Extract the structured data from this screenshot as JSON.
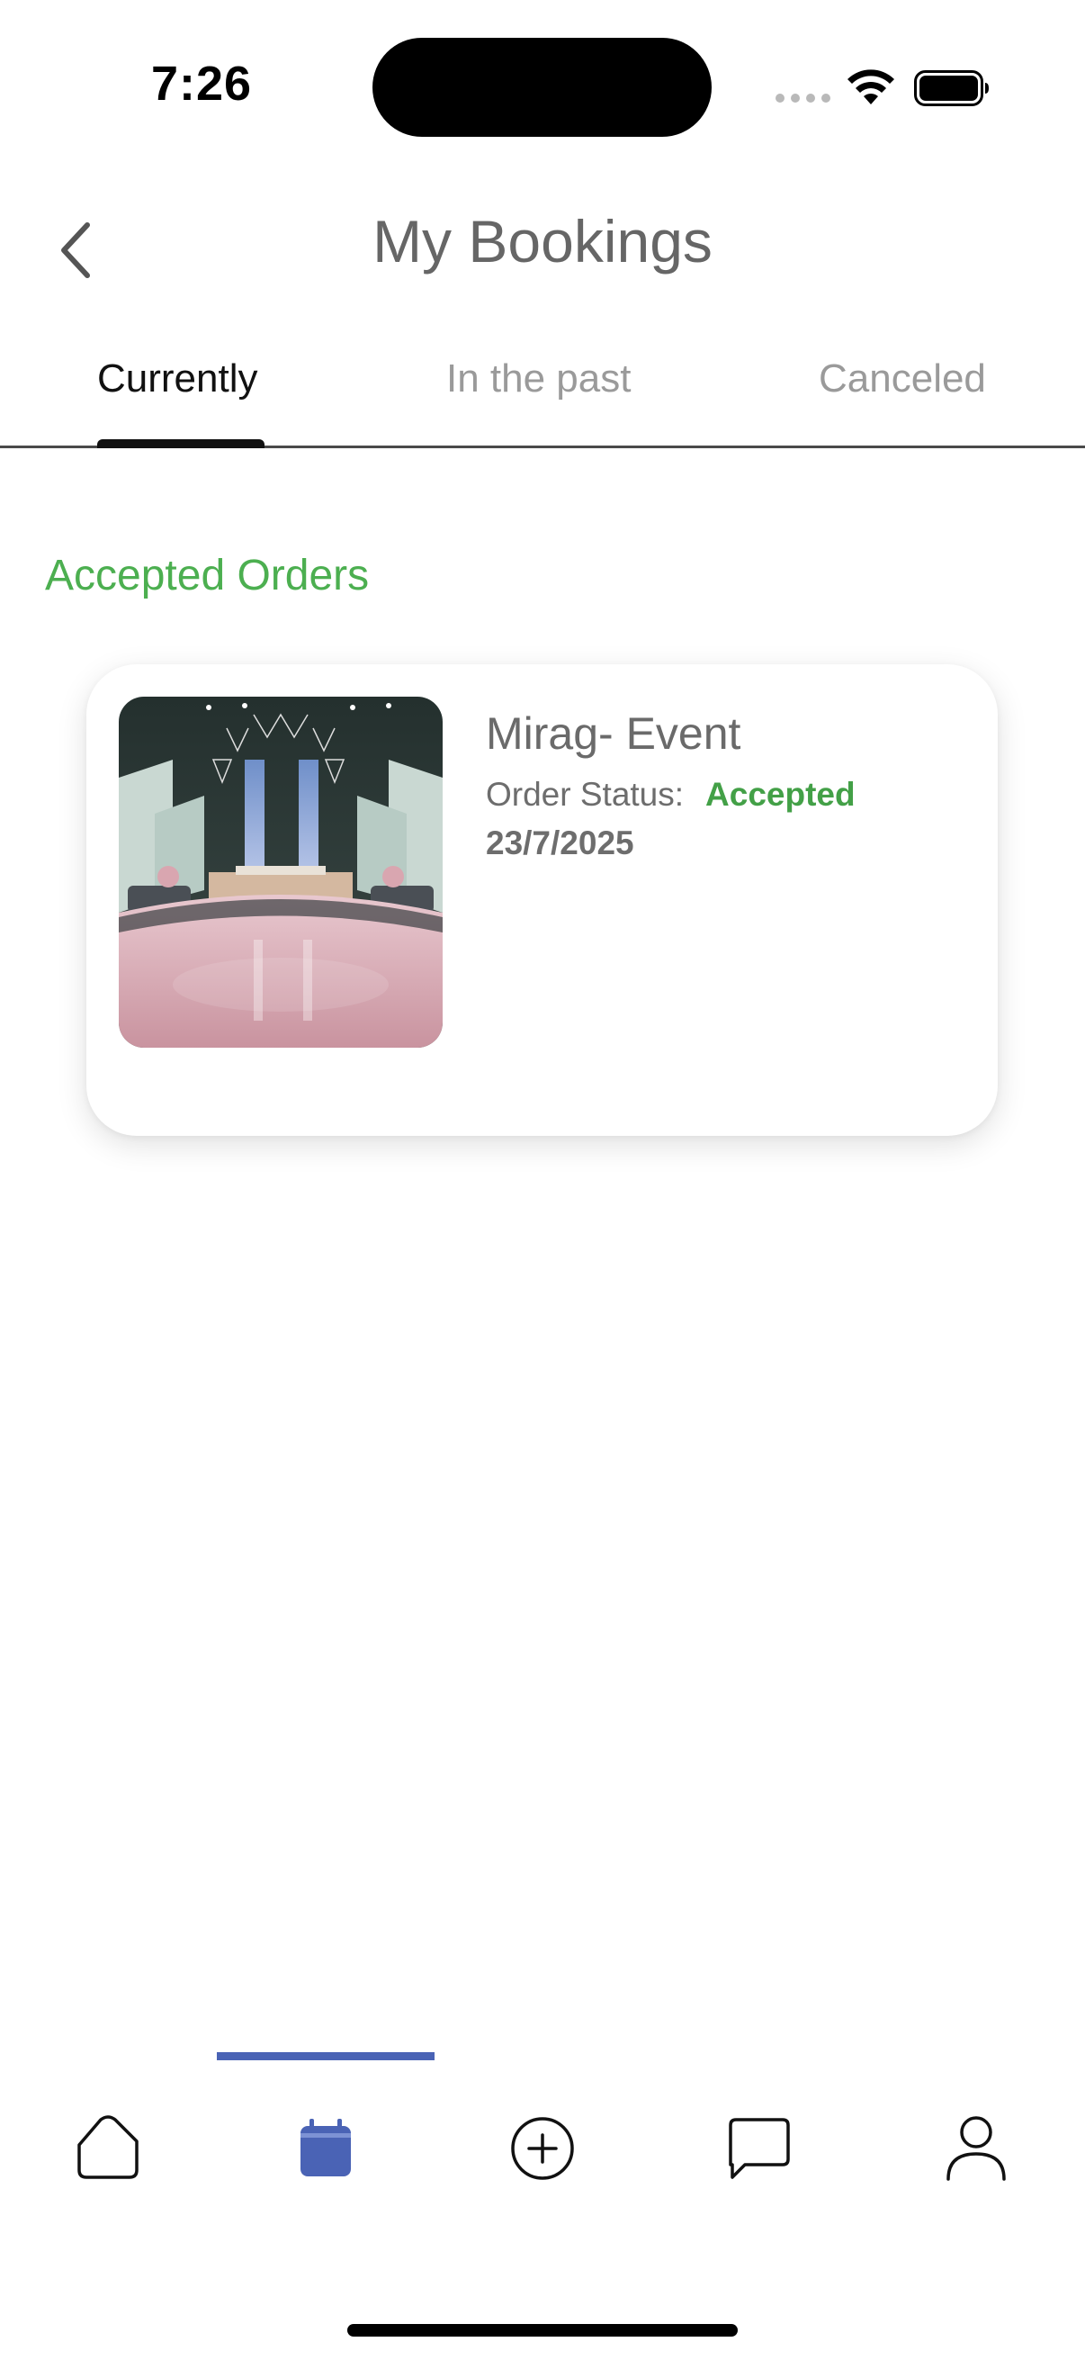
{
  "status_bar": {
    "time": "7:26"
  },
  "header": {
    "title": "My Bookings",
    "back_icon": "chevron-left-icon"
  },
  "tabs": [
    {
      "label": "Currently",
      "active": true
    },
    {
      "label": "In the past",
      "active": false
    },
    {
      "label": "Canceled",
      "active": false
    }
  ],
  "section": {
    "title": "Accepted Orders"
  },
  "orders": [
    {
      "venue_name": "Mirag- Event",
      "status_label": "Order Status:",
      "status_value": "Accepted",
      "date": "23/7/2025",
      "image": "event-hall-photo"
    }
  ],
  "bottom_nav": {
    "items": [
      {
        "icon": "home-icon",
        "active": false
      },
      {
        "icon": "calendar-icon",
        "active": true
      },
      {
        "icon": "add-circle-icon",
        "active": false
      },
      {
        "icon": "chat-icon",
        "active": false
      },
      {
        "icon": "profile-icon",
        "active": false
      }
    ]
  },
  "colors": {
    "accent_green": "#4caf50",
    "status_green": "#43a047",
    "nav_active": "#4a63b5",
    "title_gray": "#666666"
  }
}
